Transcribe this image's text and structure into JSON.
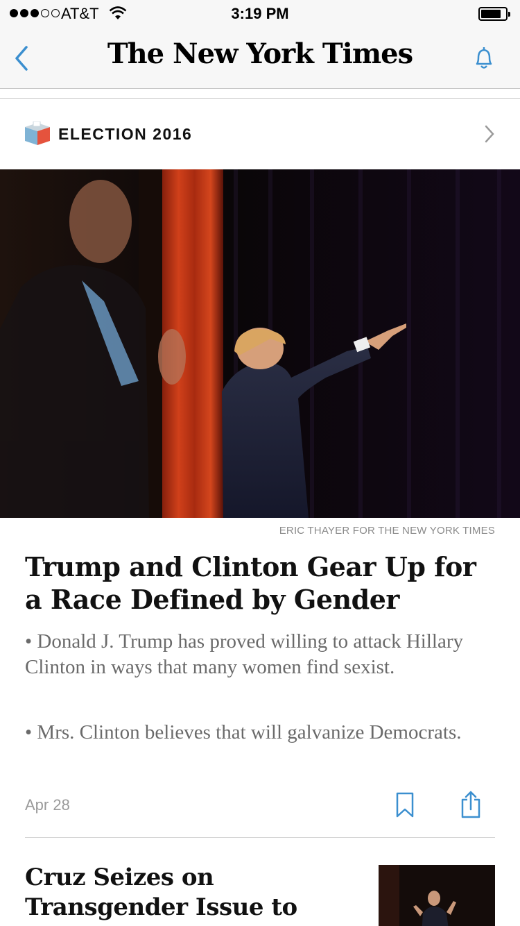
{
  "status_bar": {
    "carrier": "AT&T",
    "time": "3:19 PM",
    "signal_bars": 3,
    "signal_total": 5,
    "battery_level": 0.7
  },
  "nav": {
    "masthead": "The New York Times",
    "back_icon": "chevron-left-icon",
    "bell_icon": "bell-icon"
  },
  "section": {
    "label": "ELECTION 2016",
    "icon": "ballot-box-icon"
  },
  "article": {
    "photo_credit": "ERIC THAYER FOR THE NEW YORK TIMES",
    "headline": "Trump and Clinton Gear Up for a Race Defined by Gender",
    "bullet1": "•  Donald J. Trump has proved willing to attack Hillary Clinton in ways that many women find sexist.",
    "bullet2": "• Mrs. Clinton believes that will galvanize Democrats.",
    "date": "Apr 28",
    "bookmark_icon": "bookmark-icon",
    "share_icon": "share-icon"
  },
  "next_article": {
    "headline": "Cruz Seizes on Transgender Issue to Attack Trump"
  },
  "colors": {
    "accent": "#3b8fcf",
    "curtain": "#c8371a",
    "muted_text": "#6a6a6a"
  }
}
